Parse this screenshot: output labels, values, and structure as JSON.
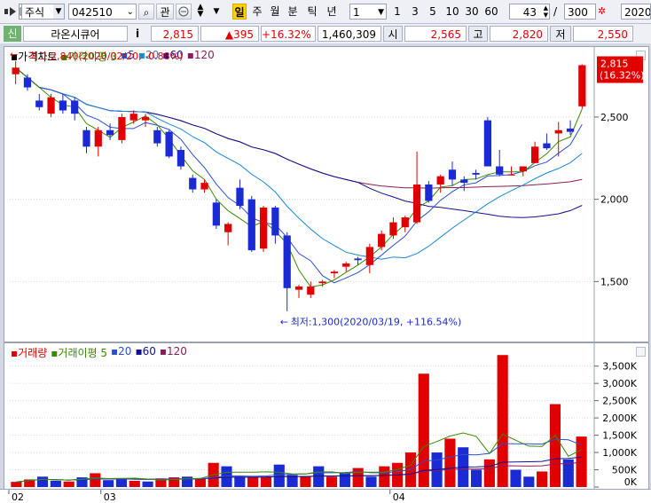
{
  "toolbar": {
    "market_select": "주식",
    "code": "042510",
    "btn_search": "⌕",
    "btn_related": "관",
    "periods": [
      "일",
      "주",
      "월",
      "분",
      "틱",
      "년"
    ],
    "active_period": "일",
    "interval_value": "1",
    "quick_intervals": [
      "1",
      "3",
      "5",
      "10",
      "30",
      "60"
    ],
    "display_count": "43",
    "total_count": "300",
    "date_value": "2020/"
  },
  "info": {
    "badge": "신",
    "name": "라온시큐어",
    "info_icon": "i",
    "price": "2,815",
    "change": "▲395",
    "change_rate": "+16.32%",
    "volume": "1,460,309",
    "open_label": "시",
    "open": "2,565",
    "high_label": "고",
    "high": "2,820",
    "low_label": "저",
    "low": "2,550"
  },
  "price_panel": {
    "legend": [
      {
        "text": "가격차트",
        "color": "#000000"
      },
      {
        "text": "가격이평 3",
        "color": "#3a8a00"
      },
      {
        "text": "5",
        "color": "#2a4fcf"
      },
      {
        "text": "20",
        "color": "#1c88d8"
      },
      {
        "text": "60",
        "color": "#101090"
      },
      {
        "text": "120",
        "color": "#8c1c5c"
      }
    ],
    "high_annotation": "최고:2,840(2020/02/20, -0.88%)",
    "low_annotation": "최저:1,300(2020/03/19, +116.54%)",
    "last_price_tag": "2,815",
    "last_rate_tag": "(16.32%)",
    "tag_color": "#e00000"
  },
  "volume_panel": {
    "legend": [
      {
        "text": "거래량",
        "color": "#e00000"
      },
      {
        "text": "거래이평 5",
        "color": "#3a8a00"
      },
      {
        "text": "20",
        "color": "#2a4fcf"
      },
      {
        "text": "60",
        "color": "#101090"
      },
      {
        "text": "120",
        "color": "#8c1c5c"
      }
    ]
  },
  "x_axis_labels": [
    {
      "label": "02",
      "index": 0
    },
    {
      "label": "03",
      "index": 7
    },
    {
      "label": "04",
      "index": 29
    }
  ],
  "colors": {
    "up": "#e00000",
    "down": "#1a2bd6",
    "ma3": "#3a8a00",
    "ma5": "#2a4fcf",
    "ma20": "#1c88d8",
    "ma60": "#101090",
    "ma120": "#8c1c5c"
  },
  "chart_data": [
    {
      "type": "candlestick",
      "title": "가격차트",
      "ylim": [
        1200,
        2850
      ],
      "yticks": [
        1500,
        2000,
        2500
      ],
      "ytick_labels": [
        "1,500",
        "2,000",
        "2,500"
      ],
      "ohlc": [
        [
          2760,
          2840,
          2700,
          2800
        ],
        [
          2740,
          2760,
          2660,
          2680
        ],
        [
          2600,
          2640,
          2540,
          2560
        ],
        [
          2520,
          2640,
          2500,
          2620
        ],
        [
          2600,
          2640,
          2520,
          2540
        ],
        [
          2600,
          2620,
          2480,
          2520
        ],
        [
          2420,
          2440,
          2280,
          2320
        ],
        [
          2320,
          2440,
          2260,
          2420
        ],
        [
          2420,
          2460,
          2360,
          2390
        ],
        [
          2360,
          2520,
          2340,
          2500
        ],
        [
          2480,
          2540,
          2460,
          2520
        ],
        [
          2480,
          2520,
          2440,
          2500
        ],
        [
          2420,
          2440,
          2320,
          2340
        ],
        [
          2410,
          2420,
          2250,
          2260
        ],
        [
          2300,
          2320,
          2180,
          2200
        ],
        [
          2130,
          2150,
          2040,
          2060
        ],
        [
          2060,
          2120,
          2040,
          2100
        ],
        [
          1980,
          2000,
          1820,
          1840
        ],
        [
          1800,
          1860,
          1720,
          1850
        ],
        [
          2070,
          2120,
          1940,
          1960
        ],
        [
          2000,
          2020,
          1680,
          1690
        ],
        [
          1700,
          1960,
          1680,
          1950
        ],
        [
          1950,
          1960,
          1730,
          1780
        ],
        [
          1780,
          1800,
          1320,
          1460
        ],
        [
          1450,
          1480,
          1400,
          1470
        ],
        [
          1420,
          1500,
          1400,
          1470
        ],
        [
          1490,
          1510,
          1470,
          1500
        ],
        [
          1550,
          1570,
          1520,
          1560
        ],
        [
          1590,
          1620,
          1560,
          1610
        ],
        [
          1640,
          1650,
          1600,
          1630
        ],
        [
          1600,
          1730,
          1550,
          1710
        ],
        [
          1710,
          1810,
          1690,
          1790
        ],
        [
          1780,
          1890,
          1760,
          1860
        ],
        [
          1830,
          1900,
          1800,
          1890
        ],
        [
          1860,
          2290,
          1850,
          2090
        ],
        [
          2090,
          2110,
          1980,
          1990
        ],
        [
          2090,
          2150,
          2040,
          2140
        ],
        [
          2180,
          2230,
          2080,
          2120
        ],
        [
          2120,
          2140,
          2050,
          2100
        ],
        [
          2160,
          2180,
          2120,
          2150
        ],
        [
          2480,
          2500,
          2200,
          2200
        ],
        [
          2200,
          2300,
          2140,
          2150
        ],
        [
          2150,
          2200,
          2150,
          2150
        ],
        [
          2170,
          2200,
          2140,
          2200
        ],
        [
          2220,
          2350,
          2220,
          2320
        ],
        [
          2340,
          2400,
          2300,
          2310
        ],
        [
          2400,
          2470,
          2260,
          2420
        ],
        [
          2430,
          2480,
          2390,
          2410
        ],
        [
          2565,
          2820,
          2550,
          2815
        ]
      ]
    },
    {
      "type": "bar",
      "title": "거래량",
      "ylim": [
        0,
        3800000
      ],
      "yticks": [
        0,
        500000,
        1000000,
        1500000,
        2000000,
        2500000,
        3000000,
        3500000
      ],
      "ytick_labels": [
        "0K",
        "500K",
        "1,000K",
        "1,500K",
        "2,000K",
        "2,500K",
        "3,000K",
        "3,500K"
      ],
      "values": [
        150000,
        220000,
        300000,
        180000,
        160000,
        280000,
        400000,
        200000,
        220000,
        180000,
        160000,
        250000,
        280000,
        300000,
        250000,
        700000,
        600000,
        300000,
        300000,
        300000,
        650000,
        350000,
        300000,
        600000,
        300000,
        400000,
        550000,
        300000,
        600000,
        700000,
        1000000,
        3280000,
        1000000,
        1400000,
        1150000,
        500000,
        800000,
        3820000,
        500000,
        300000,
        450000,
        2400000,
        800000,
        1460309
      ],
      "up": [
        true,
        true,
        false,
        false,
        true,
        false,
        true,
        false,
        false,
        true,
        false,
        true,
        true,
        false,
        true,
        true,
        false,
        false,
        true,
        true,
        false,
        false,
        true,
        false,
        true,
        false,
        true,
        false,
        true,
        true,
        true,
        true,
        false,
        true,
        false,
        false,
        true,
        true,
        false,
        false,
        true,
        true,
        false,
        true
      ]
    }
  ]
}
